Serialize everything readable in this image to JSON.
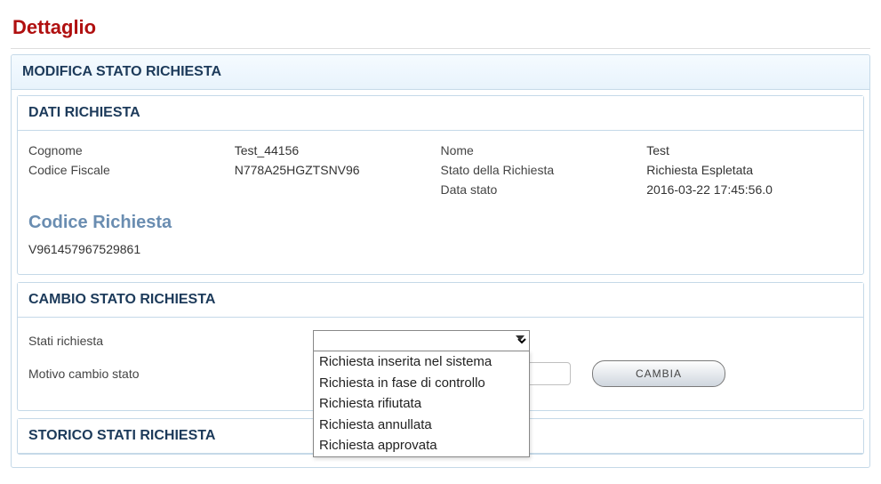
{
  "page": {
    "title": "Dettaglio"
  },
  "panel_modifica": {
    "title": "MODIFICA STATO RICHIESTA"
  },
  "panel_dati": {
    "title": "DATI RICHIESTA",
    "labels": {
      "cognome": "Cognome",
      "nome": "Nome",
      "codice_fiscale": "Codice Fiscale",
      "stato_richiesta": "Stato della Richiesta",
      "data_stato": "Data stato"
    },
    "values": {
      "cognome": "Test_44156",
      "nome": "Test",
      "codice_fiscale": "N778A25HGZTSNV96",
      "stato_richiesta": "Richiesta Espletata",
      "data_stato": "2016-03-22 17:45:56.0"
    },
    "subtitle": "Codice Richiesta",
    "code": "V961457967529861"
  },
  "panel_cambio": {
    "title": "CAMBIO STATO RICHIESTA",
    "labels": {
      "stati_richiesta": "Stati richiesta",
      "motivo": "Motivo cambio stato"
    },
    "motivo_value": "",
    "options": [
      "Richiesta inserita nel sistema",
      "Richiesta in fase di controllo",
      "Richiesta rifiutata",
      "Richiesta annullata",
      "Richiesta approvata"
    ],
    "button_label": "CAMBIA"
  },
  "panel_storico": {
    "title": "STORICO STATI RICHIESTA"
  }
}
